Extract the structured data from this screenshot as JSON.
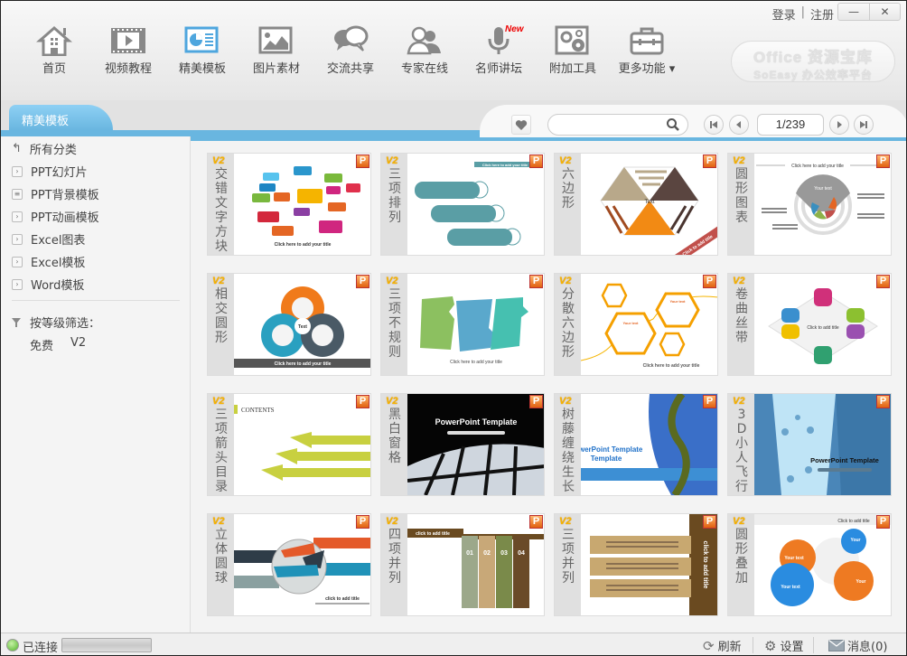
{
  "header": {
    "nav": [
      {
        "label": "首页",
        "icon": "home-icon"
      },
      {
        "label": "视频教程",
        "icon": "film-icon"
      },
      {
        "label": "精美模板",
        "icon": "presentation-icon",
        "active": true
      },
      {
        "label": "图片素材",
        "icon": "picture-icon"
      },
      {
        "label": "交流共享",
        "icon": "chat-bubbles-icon"
      },
      {
        "label": "专家在线",
        "icon": "users-icon"
      },
      {
        "label": "名师讲坛",
        "icon": "microphone-icon",
        "badge": "New"
      },
      {
        "label": "附加工具",
        "icon": "gears-icon"
      },
      {
        "label": "更多功能 ▾",
        "icon": "toolbox-icon"
      }
    ],
    "login": "登录",
    "separator": "|",
    "register": "注册",
    "minimize": "—",
    "close": "✕",
    "brand_line1": "Office 资源宝库",
    "brand_line2": "SoEasy 办公效率平台"
  },
  "tabbar": {
    "active_tab": "精美模板",
    "search": {
      "value": "",
      "placeholder": ""
    },
    "page_indicator": "1/239"
  },
  "sidebar": {
    "all_categories": "所有分类",
    "categories": [
      {
        "label": "PPT幻灯片",
        "icon": "expand-icon"
      },
      {
        "label": "PPT背景模板",
        "icon": "list-icon"
      },
      {
        "label": "PPT动画模板",
        "icon": "expand-icon"
      },
      {
        "label": "Excel图表",
        "icon": "expand-icon"
      },
      {
        "label": "Excel模板",
        "icon": "expand-icon"
      },
      {
        "label": "Word模板",
        "icon": "expand-icon"
      }
    ],
    "filter_label": "按等级筛选：",
    "filter_options": [
      "免费",
      "V2"
    ]
  },
  "templates": [
    {
      "level": "V2",
      "title": "交错文字方块",
      "thumb_text": "Click here to add your title"
    },
    {
      "level": "V2",
      "title": "三项排列",
      "thumb_text": "Click here to add your title"
    },
    {
      "level": "V2",
      "title": "六边形",
      "thumb_text": "Click to add title"
    },
    {
      "level": "V2",
      "title": "圆形图表",
      "thumb_text": "Click here to add your title"
    },
    {
      "level": "V2",
      "title": "相交圆形",
      "thumb_text": "Click here to add your title"
    },
    {
      "level": "V2",
      "title": "三项不规则",
      "thumb_text": "Click here to add your title"
    },
    {
      "level": "V2",
      "title": "分散六边形",
      "thumb_text": "Click here to add your title"
    },
    {
      "level": "V2",
      "title": "卷曲丝带",
      "thumb_text": "Click to add title"
    },
    {
      "level": "V2",
      "title": "三项箭头目录",
      "thumb_text": "CONTENTS"
    },
    {
      "level": "V2",
      "title": "黑白窗格",
      "thumb_text": "PowerPoint Template"
    },
    {
      "level": "V2",
      "title": "树藤缠绕生长",
      "thumb_text": "PowerPoint Template"
    },
    {
      "level": "V2",
      "title": "3D小人飞行",
      "thumb_text": "PowerPoint Template"
    },
    {
      "level": "V2",
      "title": "立体圆球",
      "thumb_text": "click to add title"
    },
    {
      "level": "V2",
      "title": "四项并列",
      "thumb_text": "click to add title"
    },
    {
      "level": "V2",
      "title": "三项并列",
      "thumb_text": "click to add title"
    },
    {
      "level": "V2",
      "title": "圆形叠加",
      "thumb_text": "Click to add title"
    }
  ],
  "ppt_badge": "P",
  "status": {
    "connection": "已连接",
    "refresh": "刷新",
    "settings": "设置",
    "messages": "消息(0)"
  },
  "colors": {
    "accent": "#69b6e0",
    "badge_gold": "#f6b500",
    "ppt_orange": "#e06010"
  }
}
